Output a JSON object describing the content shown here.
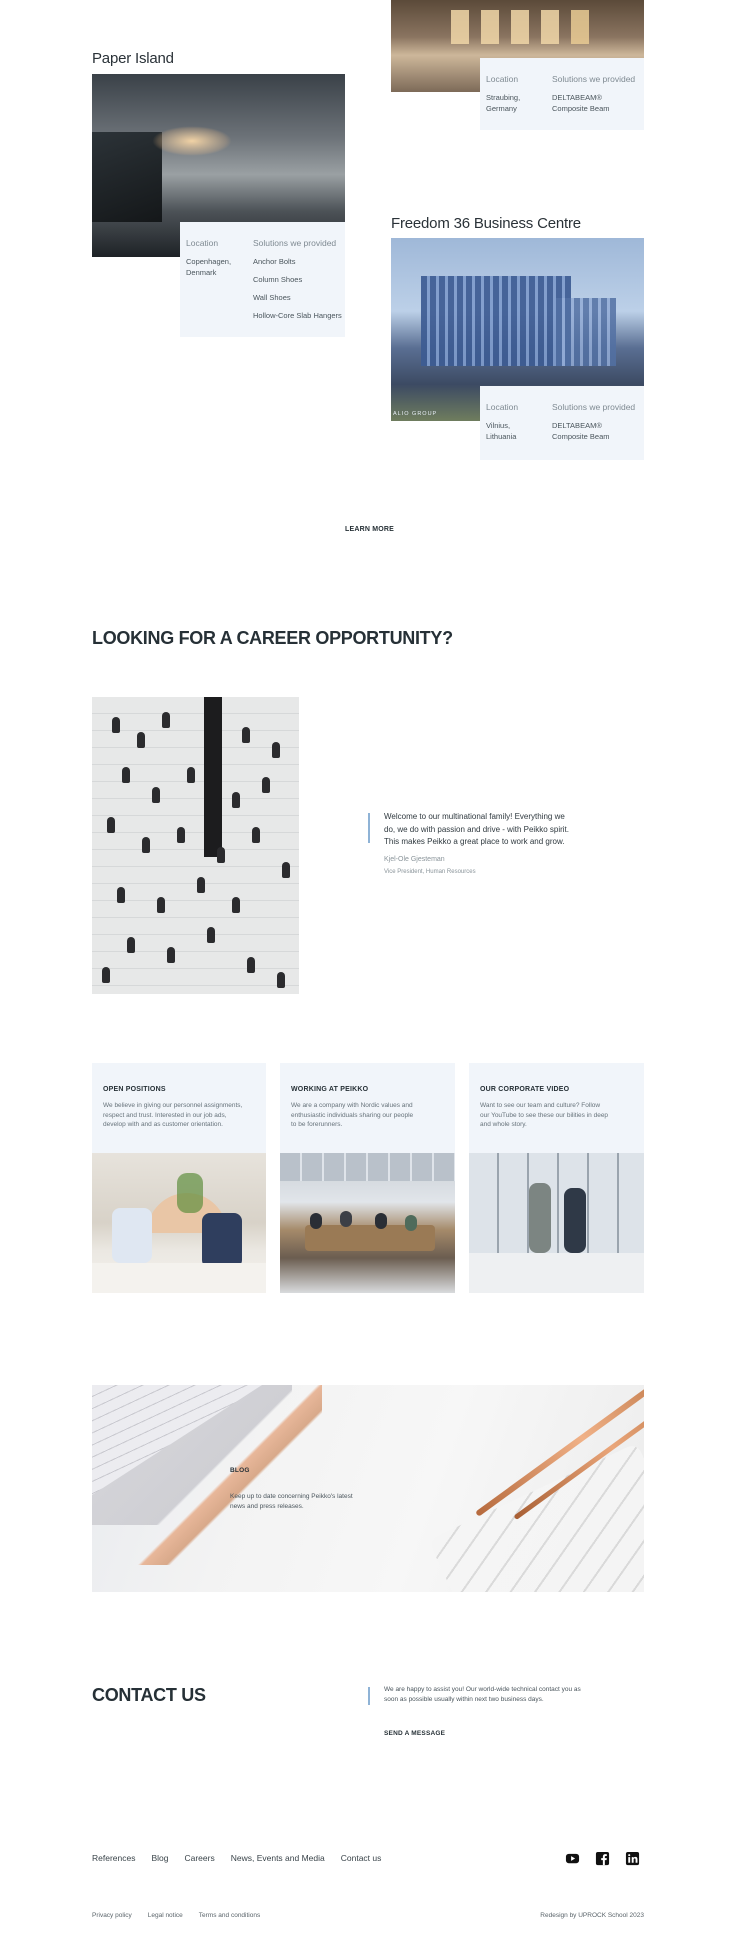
{
  "projects": {
    "top_right": {
      "location_label": "Location",
      "solutions_label": "Solutions we provided",
      "location": [
        "Straubing,",
        "Germany"
      ],
      "solutions": [
        "DELTABEAM®",
        "Composite Beam"
      ]
    },
    "paper_island": {
      "title": "Paper Island",
      "location_label": "Location",
      "solutions_label": "Solutions we provided",
      "location": [
        "Copenhagen,",
        "Denmark"
      ],
      "solutions": [
        "Anchor Bolts",
        "Column Shoes",
        "Wall Shoes",
        "Hollow-Core Slab Hangers"
      ]
    },
    "freedom36": {
      "title": "Freedom 36 Business Centre",
      "photo_caption": "ALIO GROUP",
      "location_label": "Location",
      "solutions_label": "Solutions we provided",
      "location": [
        "Vilnius,",
        "Lithuania"
      ],
      "solutions": [
        "DELTABEAM®",
        "Composite Beam"
      ]
    },
    "learn_more": "LEARN MORE"
  },
  "career": {
    "title": "LOOKING FOR A CAREER OPPORTUNITY?",
    "quote_lines": [
      "Welcome to our multinational family! Everything we",
      "do, we do with passion and drive - with Peikko spirit.",
      "This makes Peikko a great place to work and grow."
    ],
    "author_name": "Kjel-Ole Gjesteman",
    "author_role": "Vice President, Human Resources",
    "cards": [
      {
        "title": "OPEN POSITIONS",
        "lines": [
          "We believe in giving our personnel assignments,",
          "respect and trust. Interested in our job ads,",
          "develop with and as customer orientation."
        ]
      },
      {
        "title": "WORKING AT PEIKKO",
        "lines": [
          "We are a company with Nordic values and",
          "enthusiastic individuals sharing our people",
          "to be forerunners."
        ]
      },
      {
        "title": "OUR CORPORATE VIDEO",
        "lines": [
          "Want to see our team and culture? Follow",
          "our YouTube to see these our bilities in deep",
          "and whole story."
        ]
      }
    ]
  },
  "blog": {
    "title": "BLOG",
    "lines": [
      "Keep up to date concerning Peikko's latest",
      "news and press releases."
    ]
  },
  "contact": {
    "title": "CONTACT US",
    "lines": [
      "We are happy to assist you! Our world-wide technical contact you as",
      "soon as possible usually within next two business days."
    ],
    "send_label": "SEND A MESSAGE"
  },
  "footer": {
    "nav": [
      "References",
      "Blog",
      "Careers",
      "News, Events and Media",
      "Contact us"
    ],
    "social_icons": [
      "youtube-icon",
      "facebook-icon",
      "linkedin-icon"
    ],
    "legal": [
      "Privacy policy",
      "Legal notice",
      "Terms and conditions"
    ],
    "credit": "Redesign by UPROCK School 2023"
  },
  "colors": {
    "infobox_bg": "#f1f5fa",
    "accent_bar": "#8fb3d6",
    "text_dark": "#263036"
  }
}
